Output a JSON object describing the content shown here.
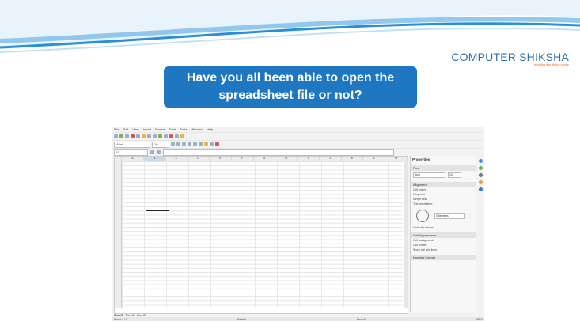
{
  "logo": {
    "name": "COMPUTER SHIKSHA",
    "tagline": "bridging the digital divide"
  },
  "question": {
    "line1": "Have you all been able to open the",
    "line2": "spreadsheet file or not?"
  },
  "app": {
    "menu": [
      "File",
      "Edit",
      "View",
      "Insert",
      "Format",
      "Tools",
      "Data",
      "Window",
      "Help"
    ],
    "font_name": "Arial",
    "font_size": "10",
    "name_box": "B3",
    "columns": [
      "A",
      "B",
      "C",
      "D",
      "E",
      "F",
      "G",
      "H",
      "I",
      "J",
      "K",
      "L",
      "M"
    ],
    "sheet_tabs": [
      "Sheet1",
      "Sheet2",
      "Sheet3"
    ],
    "status": {
      "sheet": "Sheet 1 / 3",
      "style": "Default",
      "sum": "Sum=0",
      "zoom": "100%"
    },
    "sidebar": {
      "title": "Properties",
      "character": "Font",
      "sidebar_font": "Arial",
      "sidebar_size": "10",
      "alignment": "Alignment",
      "cell_indent": "Cell indent:",
      "wrap_text": "Wrap text",
      "merge_cells": "Merge cells",
      "text_orientation": "Text orientation:",
      "degrees": "0 degrees",
      "vertically_stacked": "Vertically stacked",
      "cell_appearance": "Cell Appearance",
      "cell_background": "Cell background:",
      "cell_border": "Cell border:",
      "show_grid": "Show cell grid lines",
      "number_format": "Number Format"
    }
  },
  "colors": {
    "accent": "#1f77c2",
    "banner": "#2a8fd6",
    "logo_text": "#2f6fa8",
    "logo_tag": "#e07020"
  }
}
